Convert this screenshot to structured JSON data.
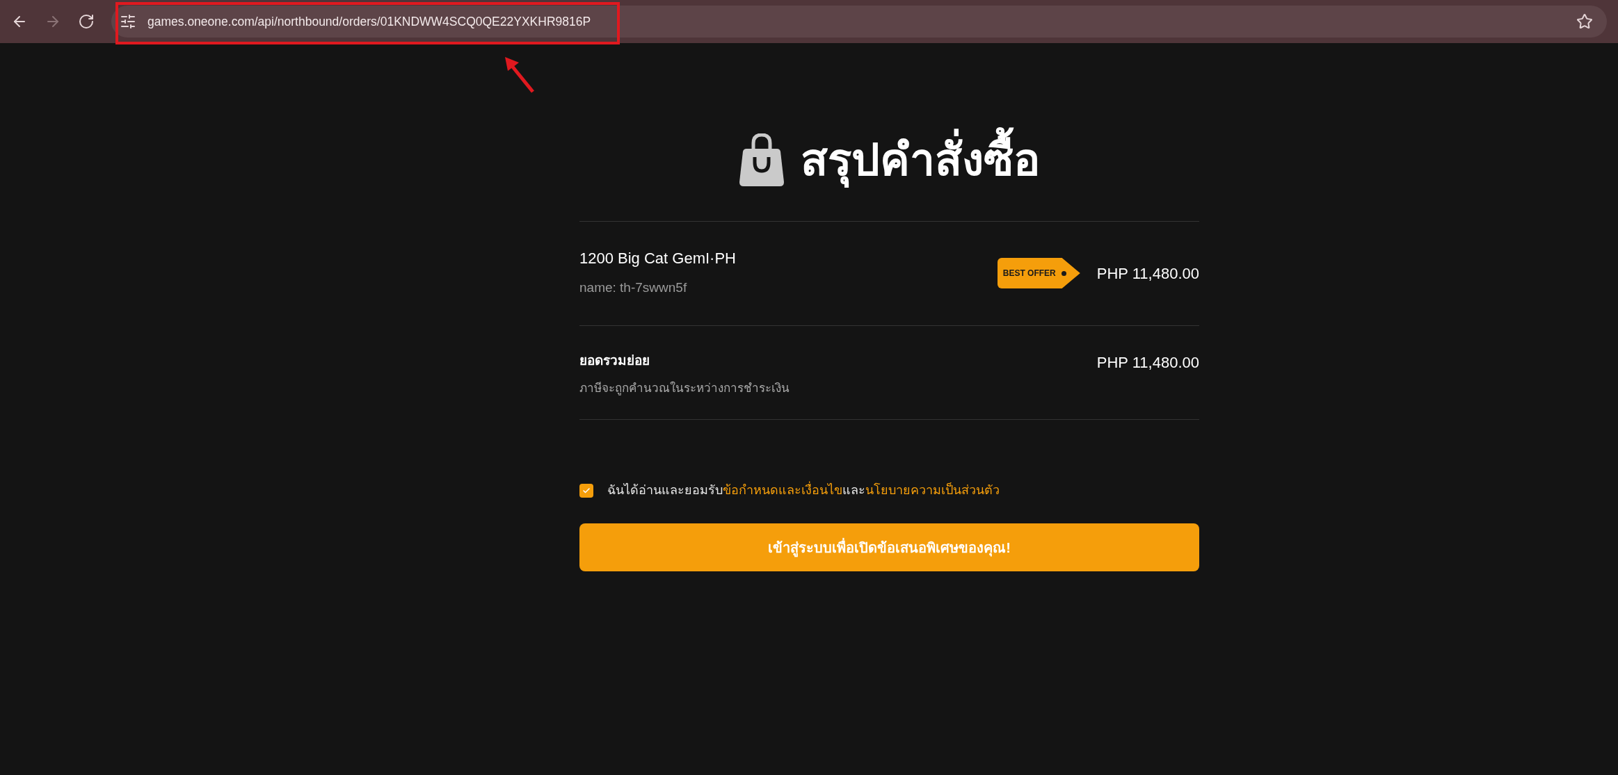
{
  "browser": {
    "url": "games.oneone.com/api/northbound/orders/01KNDWW4SCQ0QE22YXKHR9816P",
    "forward_disabled": true,
    "bookmarked": false
  },
  "annotation": {
    "kind": "highlight"
  },
  "title": "สรุปคำสั่งซื้อ",
  "items": [
    {
      "name": "1200 Big Cat GemI·PH",
      "detail": "name: th-7swwn5f",
      "tag": "BEST OFFER",
      "price": "PHP 11,480.00"
    }
  ],
  "subtotal": {
    "label": "ยอดรวมย่อย",
    "note": "ภาษีจะถูกคำนวณในระหว่างการชำระเงิน",
    "amount": "PHP 11,480.00"
  },
  "terms": {
    "checked": true,
    "parts": [
      {
        "kind": "text",
        "text": "ฉันได้อ่านและยอมรับ"
      },
      {
        "kind": "link",
        "text": "ข้อกำหนดและเงื่อนไข"
      },
      {
        "kind": "text",
        "text": "และ"
      },
      {
        "kind": "link",
        "text": "นโยบายความเป็นส่วนตัว"
      }
    ]
  },
  "submit": "เข้าสู่ระบบเพื่อเปิดข้อเสนอพิเศษของคุณ!"
}
